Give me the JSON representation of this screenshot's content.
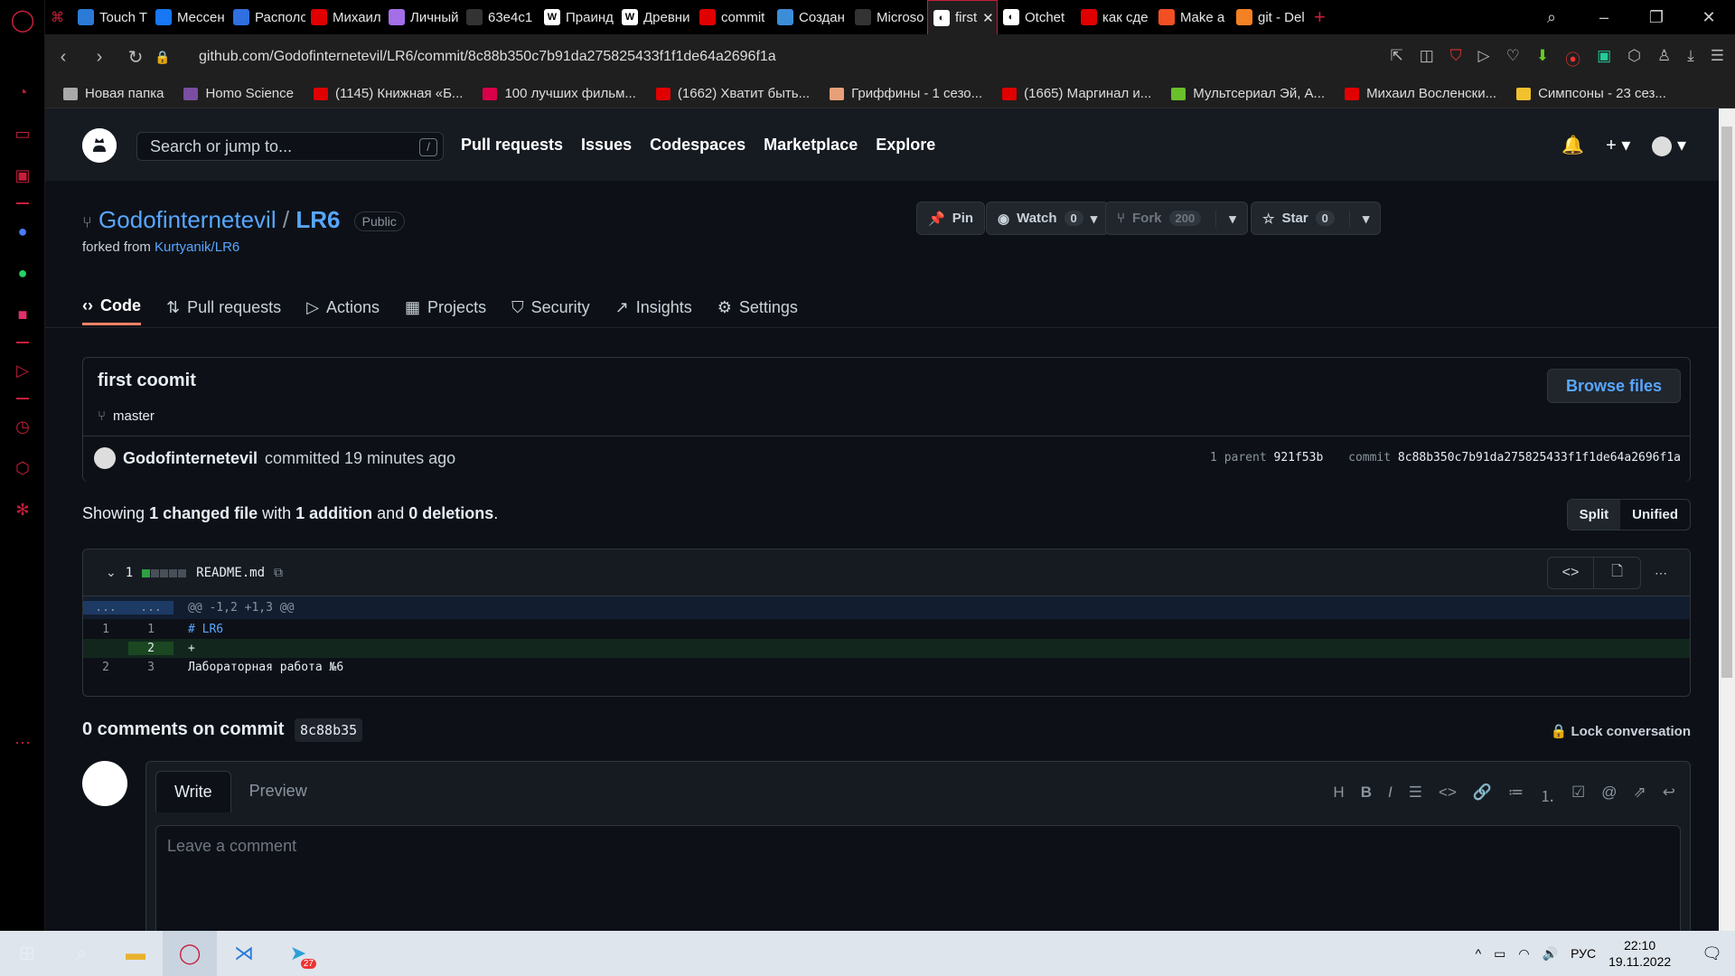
{
  "browser": {
    "tabs": [
      {
        "label": "Touch T",
        "color": "#2b7bd6",
        "icon": "touch-icon"
      },
      {
        "label": "Мессен",
        "color": "#1877f2",
        "icon": "messenger-icon"
      },
      {
        "label": "Располо",
        "color": "#2f6fe0",
        "icon": "schedule-icon"
      },
      {
        "label": "Михаил",
        "color": "#e00000",
        "icon": "play-icon"
      },
      {
        "label": "Личный",
        "color": "#a46ee8",
        "icon": "user-icon"
      },
      {
        "label": "63e4c1",
        "color": "#333333",
        "icon": "blank-icon"
      },
      {
        "label": "Праинд",
        "color": "#ffffff",
        "icon": "wiki-icon"
      },
      {
        "label": "Древни",
        "color": "#ffffff",
        "icon": "wiki-icon"
      },
      {
        "label": "commit",
        "color": "#e00000",
        "icon": "youtube-icon"
      },
      {
        "label": "Создан",
        "color": "#3c8dd8",
        "icon": "gear-icon"
      },
      {
        "label": "Microso",
        "color": "#333333",
        "icon": "blank-icon"
      },
      {
        "label": "first",
        "color": "#ffffff",
        "icon": "github-icon",
        "active": true
      },
      {
        "label": "Otchet",
        "color": "#ffffff",
        "icon": "github-icon"
      },
      {
        "label": "как сде",
        "color": "#e00000",
        "icon": "yandex-icon"
      },
      {
        "label": "Make a",
        "color": "#f25022",
        "icon": "microsoft-icon"
      },
      {
        "label": "git - Del",
        "color": "#f48024",
        "icon": "stackoverflow-icon"
      }
    ],
    "url": "github.com/Godofinternetevil/LR6/commit/8c88b350c7b91da275825433f1f1de64a2696f1a",
    "bookmarks": [
      {
        "label": "Новая папка",
        "color": "#aaaaaa"
      },
      {
        "label": "Homo Science",
        "color": "#7a4ea0"
      },
      {
        "label": "(1145) Книжная «Б...",
        "color": "#e00000"
      },
      {
        "label": "100 лучших фильм...",
        "color": "#d9004a"
      },
      {
        "label": "(1662) Хватит быть...",
        "color": "#e00000"
      },
      {
        "label": "Гриффины - 1 сезо...",
        "color": "#e8a07a"
      },
      {
        "label": "(1665) Маргинал и...",
        "color": "#e00000"
      },
      {
        "label": "Мультсериал Эй, А...",
        "color": "#6bbf2a"
      },
      {
        "label": "Михаил Восленски...",
        "color": "#e00000"
      },
      {
        "label": "Симпсоны - 23 сез...",
        "color": "#f2c12e"
      }
    ]
  },
  "github": {
    "search_placeholder": "Search or jump to...",
    "search_key": "/",
    "nav": [
      "Pull requests",
      "Issues",
      "Codespaces",
      "Marketplace",
      "Explore"
    ]
  },
  "repo": {
    "owner": "Godofinternetevil",
    "sep": "/",
    "name": "LR6",
    "visibility": "Public",
    "forked_from_label": "forked from",
    "forked_from": "Kurtyanik/LR6",
    "pin": "Pin",
    "watch": "Watch",
    "watch_count": "0",
    "fork": "Fork",
    "fork_count": "200",
    "star": "Star",
    "star_count": "0",
    "tabs": [
      {
        "label": "Code",
        "icon": "code-icon",
        "active": true
      },
      {
        "label": "Pull requests",
        "icon": "pull-request-icon"
      },
      {
        "label": "Actions",
        "icon": "play-icon"
      },
      {
        "label": "Projects",
        "icon": "table-icon"
      },
      {
        "label": "Security",
        "icon": "shield-icon"
      },
      {
        "label": "Insights",
        "icon": "graph-icon"
      },
      {
        "label": "Settings",
        "icon": "gear-icon"
      }
    ]
  },
  "commit": {
    "title": "first coomit",
    "branch": "master",
    "browse": "Browse files",
    "author": "Godofinternetevil",
    "committed": "committed 19 minutes ago",
    "parent_label": "1 parent",
    "parent": "921f53b",
    "commit_label": "commit",
    "sha": "8c88b350c7b91da275825433f1f1de64a2696f1a"
  },
  "summary": {
    "showing": "Showing",
    "changed": "1 changed file",
    "with": "with",
    "additions": "1 addition",
    "and": "and",
    "deletions": "0 deletions",
    "dot": ".",
    "split": "Split",
    "unified": "Unified"
  },
  "diff": {
    "count": "1",
    "filename": "README.md",
    "hunk": "@@ -1,2 +1,3 @@",
    "hunk_left": "...",
    "hunk_right": "...",
    "lines": [
      {
        "old": "1",
        "new": "1",
        "text": "# LR6",
        "type": "ctx"
      },
      {
        "old": "",
        "new": "2",
        "text": "+",
        "type": "add"
      },
      {
        "old": "2",
        "new": "3",
        "text": "Лабораторная работа №6",
        "type": "ctx"
      }
    ]
  },
  "comments": {
    "count_label": "0 comments on commit",
    "sha": "8c88b35",
    "lock": "Lock conversation",
    "write": "Write",
    "preview": "Preview",
    "placeholder": "Leave a comment"
  },
  "taskbar": {
    "lang": "РУС",
    "time": "22:10",
    "date": "19.11.2022",
    "telegram_badge": "27"
  }
}
